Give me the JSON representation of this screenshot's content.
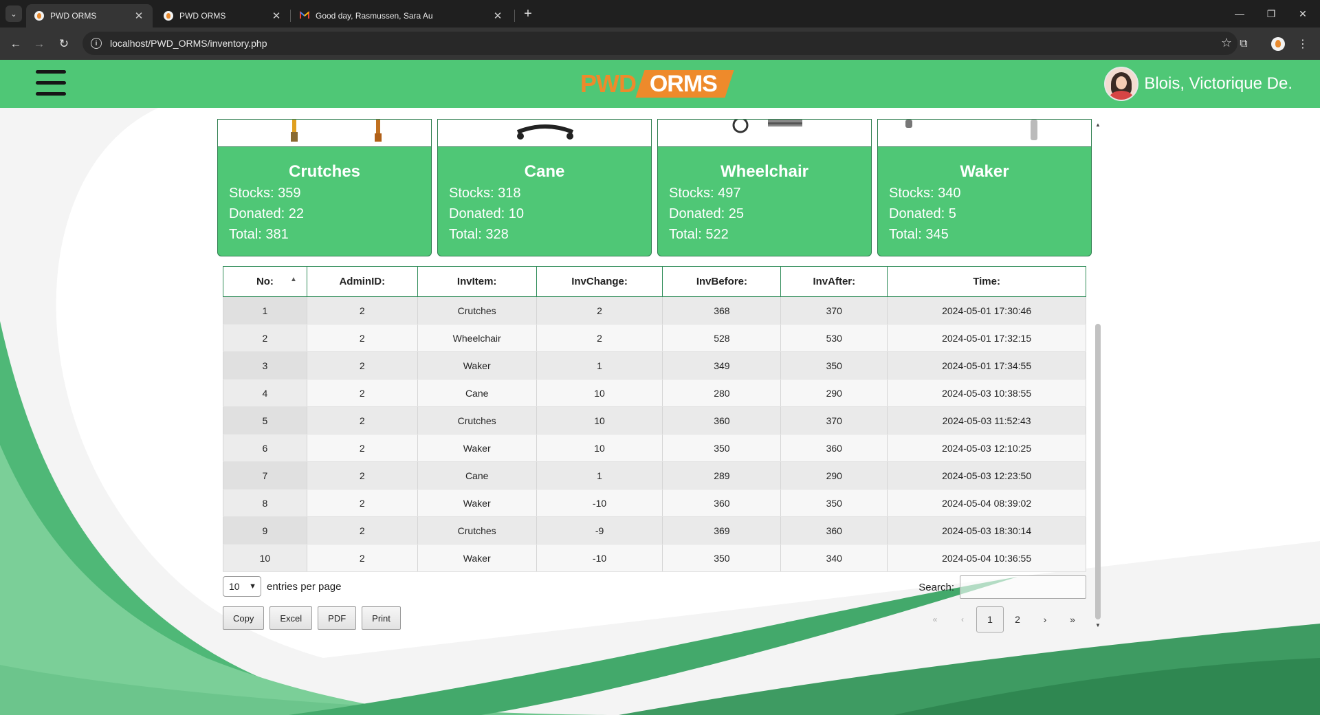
{
  "browser": {
    "tabs": [
      {
        "title": "PWD ORMS",
        "active": true
      },
      {
        "title": "PWD ORMS",
        "active": false
      },
      {
        "title": "Good day, Rasmussen, Sara Au",
        "active": false
      }
    ],
    "url": "localhost/PWD_ORMS/inventory.php"
  },
  "header": {
    "logo_left": "PWD",
    "logo_right": "ORMS",
    "user_name": "Blois, Victorique De."
  },
  "cards": [
    {
      "name": "Crutches",
      "stocks": "Stocks: 359",
      "donated": "Donated: 22",
      "total": "Total: 381"
    },
    {
      "name": "Cane",
      "stocks": "Stocks: 318",
      "donated": "Donated: 10",
      "total": "Total: 328"
    },
    {
      "name": "Wheelchair",
      "stocks": "Stocks: 497",
      "donated": "Donated: 25",
      "total": "Total: 522"
    },
    {
      "name": "Waker",
      "stocks": "Stocks: 340",
      "donated": "Donated: 5",
      "total": "Total: 345"
    }
  ],
  "table": {
    "headers": [
      "No:",
      "AdminID:",
      "InvItem:",
      "InvChange:",
      "InvBefore:",
      "InvAfter:",
      "Time:"
    ],
    "sorted_column": "No:",
    "rows": [
      [
        "1",
        "2",
        "Crutches",
        "2",
        "368",
        "370",
        "2024-05-01 17:30:46"
      ],
      [
        "2",
        "2",
        "Wheelchair",
        "2",
        "528",
        "530",
        "2024-05-01 17:32:15"
      ],
      [
        "3",
        "2",
        "Waker",
        "1",
        "349",
        "350",
        "2024-05-01 17:34:55"
      ],
      [
        "4",
        "2",
        "Cane",
        "10",
        "280",
        "290",
        "2024-05-03 10:38:55"
      ],
      [
        "5",
        "2",
        "Crutches",
        "10",
        "360",
        "370",
        "2024-05-03 11:52:43"
      ],
      [
        "6",
        "2",
        "Waker",
        "10",
        "350",
        "360",
        "2024-05-03 12:10:25"
      ],
      [
        "7",
        "2",
        "Cane",
        "1",
        "289",
        "290",
        "2024-05-03 12:23:50"
      ],
      [
        "8",
        "2",
        "Waker",
        "-10",
        "360",
        "350",
        "2024-05-04 08:39:02"
      ],
      [
        "9",
        "2",
        "Crutches",
        "-9",
        "369",
        "360",
        "2024-05-03 18:30:14"
      ],
      [
        "10",
        "2",
        "Waker",
        "-10",
        "350",
        "340",
        "2024-05-04 10:36:55"
      ]
    ]
  },
  "controls": {
    "entries_value": "10",
    "entries_label": "entries per page",
    "search_label": "Search:",
    "search_value": "",
    "buttons": [
      "Copy",
      "Excel",
      "PDF",
      "Print"
    ],
    "pager": {
      "first": "«",
      "prev": "‹",
      "pages": [
        "1",
        "2"
      ],
      "current": "1",
      "next": "›",
      "last": "»"
    }
  },
  "colors": {
    "header_green": "#4fc776",
    "logo_orange": "#ee8a2b",
    "wave_light": "#7bcf98",
    "wave_dark": "#3e9b62"
  }
}
